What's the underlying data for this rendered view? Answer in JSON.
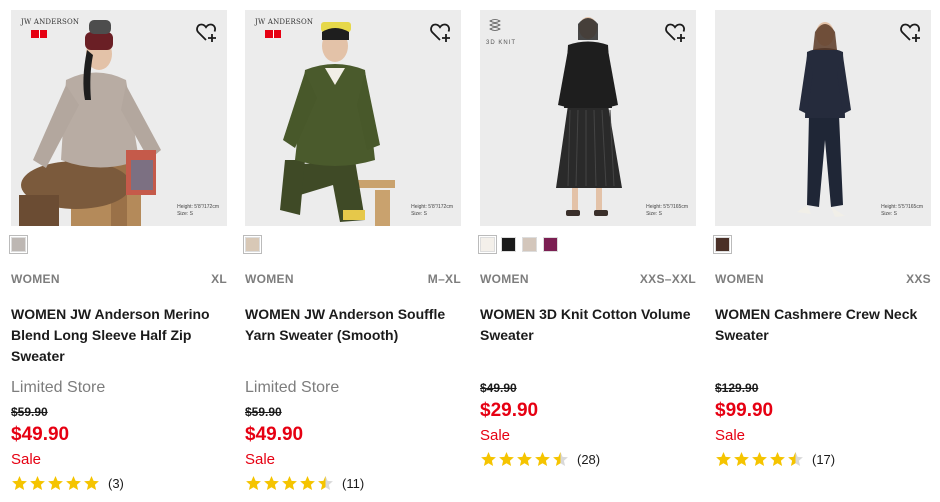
{
  "colors": {
    "sale_red": "#e60012",
    "meta_grey": "#7d7d7d",
    "star_gold": "#f5c400",
    "text_dark": "#1b1b1b"
  },
  "products": [
    {
      "brand_text": "JW ANDERSON",
      "brand_mark": "UNIQLO",
      "height_info": [
        "Height: 5'8\"/172cm",
        "Size: S"
      ],
      "swatches": [
        "#bdb7b3"
      ],
      "gender": "WOMEN",
      "size_range": "XL",
      "name": "WOMEN JW Anderson Merino Blend Long Sleeve Half Zip Sweater",
      "store_label": "Limited Store",
      "original_price": "$59.90",
      "price": "$49.90",
      "sale_label": "Sale",
      "rating_value": 5,
      "review_count": "(3)"
    },
    {
      "brand_text": "JW ANDERSON",
      "brand_mark": "UNIQLO",
      "height_info": [
        "Height: 5'8\"/172cm",
        "Size: S"
      ],
      "swatches": [
        "#d8c8b6"
      ],
      "gender": "WOMEN",
      "size_range": "M–XL",
      "name": "WOMEN JW Anderson Souffle Yarn Sweater (Smooth)",
      "store_label": "Limited Store",
      "original_price": "$59.90",
      "price": "$49.90",
      "sale_label": "Sale",
      "rating_value": 4.5,
      "review_count": "(11)"
    },
    {
      "brand_text": "3D KNIT",
      "height_info": [
        "Height: 5'5\"/165cm",
        "Size: S"
      ],
      "swatches": [
        "#f4f0ea",
        "#1a1a1a",
        "#d3c6bb",
        "#7b1f52"
      ],
      "gender": "WOMEN",
      "size_range": "XXS–XXL",
      "name": "WOMEN 3D Knit Cotton Volume Sweater",
      "original_price": "$49.90",
      "price": "$29.90",
      "sale_label": "Sale",
      "rating_value": 4.5,
      "review_count": "(28)"
    },
    {
      "height_info": [
        "Height: 5'5\"/165cm",
        "Size: S"
      ],
      "swatches": [
        "#4a3027"
      ],
      "gender": "WOMEN",
      "size_range": "XXS",
      "name": "WOMEN Cashmere Crew Neck Sweater",
      "original_price": "$129.90",
      "price": "$99.90",
      "sale_label": "Sale",
      "rating_value": 4.5,
      "review_count": "(17)"
    }
  ]
}
